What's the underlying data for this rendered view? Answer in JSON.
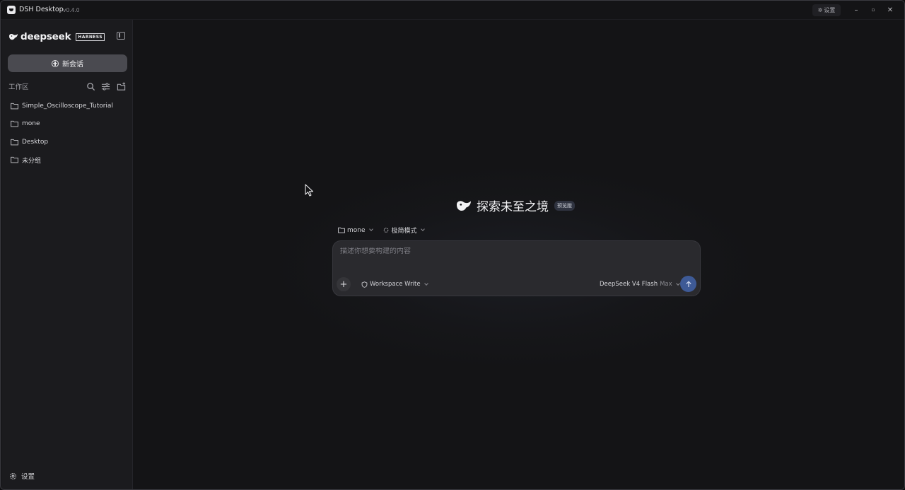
{
  "titlebar": {
    "app_name": "DSH Desktop",
    "version": "v0.4.0",
    "settings_label": "设置",
    "controls": [
      "minimize-icon",
      "maximize-icon",
      "close-icon"
    ]
  },
  "sidebar": {
    "brand_word": "deepseek",
    "brand_tag": "HARNESS",
    "new_chat_label": "新会话",
    "workspace_label": "工作区",
    "folders": [
      {
        "label": "Simple_Oscilloscope_Tutorial"
      },
      {
        "label": "mone"
      },
      {
        "label": "Desktop"
      },
      {
        "label": "未分组"
      }
    ],
    "settings_label": "设置"
  },
  "main": {
    "hero_title": "探索未至之境",
    "hero_badge": "预览版",
    "context": {
      "folder": "mone",
      "mode": "极简模式"
    },
    "composer": {
      "placeholder": "描述你想要构建的内容",
      "value": "",
      "permission": "Workspace Write",
      "model": "DeepSeek V4 Flash",
      "model_tier": "Max"
    }
  },
  "colors": {
    "accent": "#3e5a96",
    "sidebar_bg": "#1b1b1e",
    "main_bg": "#141416",
    "composer_bg": "#2a2a2e"
  }
}
